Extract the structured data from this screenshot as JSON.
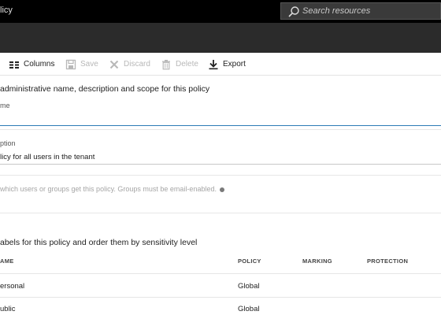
{
  "window": {
    "title": "licy"
  },
  "search": {
    "placeholder": "Search resources"
  },
  "toolbar": {
    "columns": "Columns",
    "save": "Save",
    "discard": "Discard",
    "delete": "Delete",
    "export": "Export"
  },
  "section1": {
    "heading": "administrative name, description and scope for this policy",
    "name_label": "me",
    "name_value": "",
    "description_label": "ption",
    "description_value": "licy for all users in the tenant"
  },
  "section2": {
    "hint": "which users or groups get this policy. Groups must be email-enabled."
  },
  "section3": {
    "heading": "abels for this policy and order them by sensitivity level",
    "columns": [
      "AME",
      "POLICY",
      "MARKING",
      "PROTECTION"
    ],
    "rows": [
      {
        "name": "ersonal",
        "policy": "Global",
        "marking": "",
        "protection": ""
      },
      {
        "name": "ublic",
        "policy": "Global",
        "marking": "",
        "protection": ""
      }
    ]
  }
}
